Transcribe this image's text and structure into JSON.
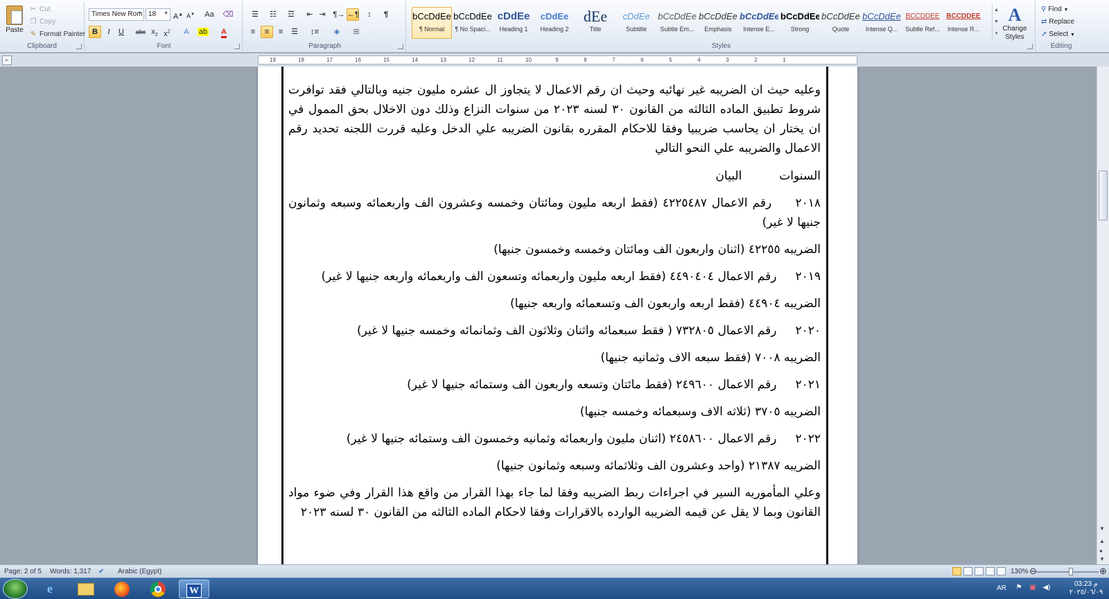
{
  "ribbon": {
    "clipboard": {
      "paste_label": "Paste",
      "cut_label": "Cut",
      "copy_label": "Copy",
      "format_painter_label": "Format Painter",
      "group_label": "Clipboard"
    },
    "font": {
      "font_name": "Times New Rom",
      "font_size": "18",
      "group_label": "Font"
    },
    "paragraph": {
      "group_label": "Paragraph"
    },
    "styles": {
      "items": [
        {
          "preview": "bCcDdEe",
          "name": "¶ Normal"
        },
        {
          "preview": "bCcDdEe",
          "name": "¶ No Spaci..."
        },
        {
          "preview": "cDdEe",
          "name": "Heading 1"
        },
        {
          "preview": "cDdEe",
          "name": "Heading 2"
        },
        {
          "preview": "dEe",
          "name": "Title"
        },
        {
          "preview": "cDdEe",
          "name": "Subtitle"
        },
        {
          "preview": "bCcDdEe",
          "name": "Subtle Em..."
        },
        {
          "preview": "bCcDdEe",
          "name": "Emphasis"
        },
        {
          "preview": "bCcDdEe",
          "name": "Intense E..."
        },
        {
          "preview": "bCcDdEe",
          "name": "Strong"
        },
        {
          "preview": "bCcDdEe",
          "name": "Quote"
        },
        {
          "preview": "bCcDdEe",
          "name": "Intense Q..."
        },
        {
          "preview": "BCCDDEE",
          "name": "Subtle Ref..."
        },
        {
          "preview": "BCCDDEE",
          "name": "Intense R..."
        }
      ],
      "change_styles_label": "Change Styles",
      "group_label": "Styles"
    },
    "editing": {
      "find_label": "Find",
      "replace_label": "Replace",
      "select_label": "Select",
      "group_label": "Editing"
    }
  },
  "ruler": {
    "ticks": [
      "19",
      "18",
      "17",
      "16",
      "15",
      "14",
      "13",
      "12",
      "11",
      "10",
      "9",
      "8",
      "7",
      "6",
      "5",
      "4",
      "3",
      "2",
      "1",
      ""
    ]
  },
  "document": {
    "paragraphs": [
      "وعليه حيث ان الضريبه غير نهائيه وحيث ان رقم الاعمال لا يتجاوز ال عشره مليون جنيه وبالتالي فقد توافرت شروط تطبيق الماده الثالثه من القانون ٣٠ لسنه ٢٠٢٣ من سنوات النزاع وذلك دون الاخلال بحق الممول في ان يختار ان يحاسب ضريبيا وفقا للاحكام المقرره بقانون الضريبه علي الدخل وعليه قررت اللجنه تحديد رقم الاعمال والضريبه علي النحو التالي",
      "السنوات          البيان",
      "٢٠١٨     رقم الاعمال ٤٢٢٥٤٨٧ (فقط اربعه مليون ومائتان وخمسه وعشرون الف واربعمائه وسبعه وثمانون جنيها لا غير)",
      "الضريبه ٤٢٢٥٥ (اثنان واربعون الف ومائتان وخمسه وخمسون جنيها)",
      "٢٠١٩     رقم الاعمال ٤٤٩٠٤٠٤ (فقط اربعه مليون واربعمائه وتسعون الف واربعمائه واربعه جنيها لا غير)",
      "الضريبه ٤٤٩٠٤ (فقط اربعه واربعون الف وتسعمائه واربعه جنيها)",
      "٢٠٢٠     رقم الاعمال ٧٣٢٨٠٥ ( فقط سبعمائه واثنان وثلاثون الف وثمانمائه وخمسه جنيها لا غير)",
      "الضريبه ٧٠٠٨ (فقط سبعه الاف وثمانيه جنيها)",
      "٢٠٢١     رقم الاعمال ٢٤٩٦٠٠ (فقط مائتان وتسعه واربعون الف وستمائه جنيها لا غير)",
      "الضريبه ٣٧٠٥ (ثلاثه الاف وسبعمائه وخمسه جنيها)",
      "٢٠٢٢     رقم الاعمال ٢٤٥٨٦٠٠ (اثنان مليون واربعمائه وثمانيه وخمسون الف وستمائه جنيها لا غير)",
      "الضريبه ٢١٣٨٧ (واحد وعشرون الف وثلاثمائه وسبعه وثمانون جنيها)",
      "وعلي المأموريه السير في اجراءات ربط الضريبه وفقا لما جاء بهذا القرار من واقع هذا القرار وفي ضوء مواد القانون وبما لا يقل عن قيمه الضريبه الوارده بالاقرارات وفقا لاحكام الماده الثالثه من القانون ٣٠ لسنه ٢٠٢٣"
    ]
  },
  "status_bar": {
    "page": "Page: 2 of 5",
    "words": "Words: 1,317",
    "language": "Arabic (Egypt)",
    "zoom": "130%"
  },
  "taskbar": {
    "lang": "AR",
    "time": "03:23 م",
    "date": "٢٠٢٥/٠٦/٠٩"
  },
  "colors": {
    "ribbon_top": "#fbfcfe",
    "ribbon_bottom": "#dde6f2",
    "taskbar": "#1f4c86",
    "selected_style": "#fde9b0",
    "heading_blue": "#2f5597",
    "intense_ref_red": "#c0392b"
  }
}
